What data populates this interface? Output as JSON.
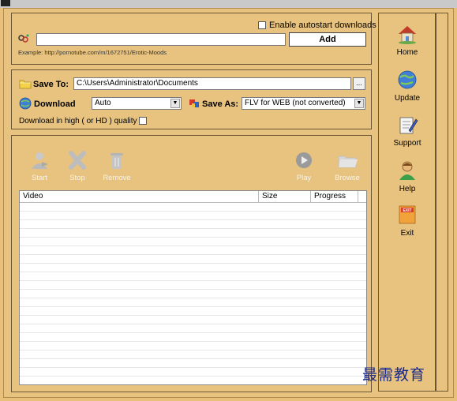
{
  "url_section": {
    "autostart_label": "Enable autostart downloads",
    "url_value": "",
    "add_label": "Add",
    "example_text": "Example:  http://pornotube.com/m/1672751/Erotic-Moods"
  },
  "save_section": {
    "save_to_label": "Save To:",
    "save_path": "C:\\Users\\Administrator\\Documents",
    "browse_dots": "...",
    "download_label": "Download",
    "download_value": "Auto",
    "save_as_label": "Save As:",
    "format_value": "FLV for WEB (not converted)",
    "hd_label": "Download in high ( or HD ) quality"
  },
  "toolbar": {
    "start": "Start",
    "stop": "Stop",
    "remove": "Remove",
    "play": "Play",
    "browse": "Browse"
  },
  "table": {
    "columns": [
      "Video",
      "Size",
      "Progress"
    ],
    "rows": []
  },
  "sidebar": {
    "items": [
      {
        "label": "Home",
        "icon": "home-icon"
      },
      {
        "label": "Update",
        "icon": "globe-update-icon"
      },
      {
        "label": "Support",
        "icon": "support-notepad-icon"
      },
      {
        "label": "Help",
        "icon": "help-person-icon"
      },
      {
        "label": "Exit",
        "icon": "exit-sign-icon"
      }
    ]
  },
  "watermark": "最需教育",
  "colors": {
    "background": "#e8c37f",
    "border": "#6b5430",
    "watermark": "#1a2a8a"
  }
}
